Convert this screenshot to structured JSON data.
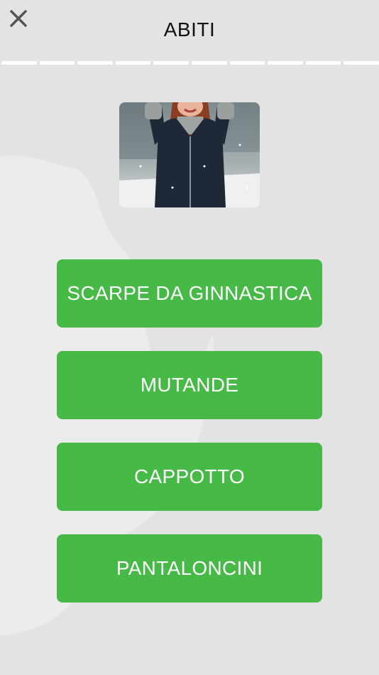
{
  "header": {
    "title": "ABITI",
    "close_icon": "close-icon"
  },
  "progress": {
    "total_segments": 10
  },
  "image": {
    "subject": "woman-in-winter-coat"
  },
  "answers": [
    {
      "label": "SCARPE DA GINNASTICA"
    },
    {
      "label": "MUTANDE"
    },
    {
      "label": "CAPPOTTO"
    },
    {
      "label": "PANTALONCINI"
    }
  ],
  "colors": {
    "background": "#e3e3e3",
    "answer_button": "#46b947",
    "answer_text": "#ffffff",
    "progress_segment": "#ffffff"
  }
}
